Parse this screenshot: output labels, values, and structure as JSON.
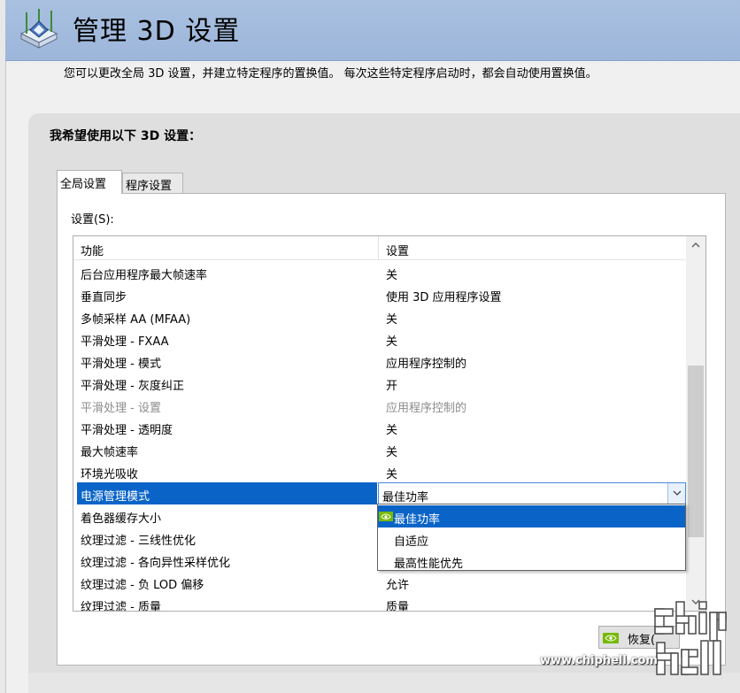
{
  "window": {
    "title": "管理 3D 设置",
    "description": "您可以更改全局 3D 设置，并建立特定程序的置换值。 每次这些特定程序启动时，都会自动使用置换值。"
  },
  "section": {
    "heading": "我希望使用以下 3D 设置："
  },
  "tabs": [
    {
      "label": "全局设置",
      "active": true
    },
    {
      "label": "程序设置",
      "active": false
    }
  ],
  "settings_label": "设置(S):",
  "table": {
    "columns": [
      "功能",
      "设置"
    ],
    "rows": [
      {
        "feature": "后台应用程序最大帧速率",
        "value": "关"
      },
      {
        "feature": "垂直同步",
        "value": "使用 3D 应用程序设置"
      },
      {
        "feature": "多帧采样 AA (MFAA)",
        "value": "关"
      },
      {
        "feature": "平滑处理 - FXAA",
        "value": "关"
      },
      {
        "feature": "平滑处理 - 模式",
        "value": "应用程序控制的"
      },
      {
        "feature": "平滑处理 - 灰度纠正",
        "value": "开"
      },
      {
        "feature": "平滑处理 - 设置",
        "value": "应用程序控制的",
        "disabled": true
      },
      {
        "feature": "平滑处理 - 透明度",
        "value": "关"
      },
      {
        "feature": "最大帧速率",
        "value": "关"
      },
      {
        "feature": "环境光吸收",
        "value": "关"
      },
      {
        "feature": "电源管理模式",
        "value": "最佳功率",
        "selected": true
      },
      {
        "feature": "着色器缓存大小",
        "value": ""
      },
      {
        "feature": "纹理过滤 - 三线性优化",
        "value": ""
      },
      {
        "feature": "纹理过滤 - 各向异性采样优化",
        "value": ""
      },
      {
        "feature": "纹理过滤 - 负 LOD 偏移",
        "value": "允许"
      },
      {
        "feature": "纹理过滤 - 质量",
        "value": "质量"
      }
    ]
  },
  "dropdown": {
    "selected": "最佳功率",
    "options": [
      "最佳功率",
      "自适应",
      "最高性能优先"
    ],
    "highlighted_index": 0
  },
  "buttons": {
    "restore_label": "恢复("
  },
  "watermark": {
    "url": "www.chiphell.com",
    "logo_text": "chip hell"
  },
  "colors": {
    "header": "#9cb6da",
    "selection": "#0a64c8",
    "nvidia_green": "#76b900"
  },
  "icons": [
    "nvidia-3d-icon",
    "chevron-down-icon",
    "scroll-up-arrow-icon",
    "scroll-down-arrow-icon",
    "nvidia-logo-icon"
  ]
}
